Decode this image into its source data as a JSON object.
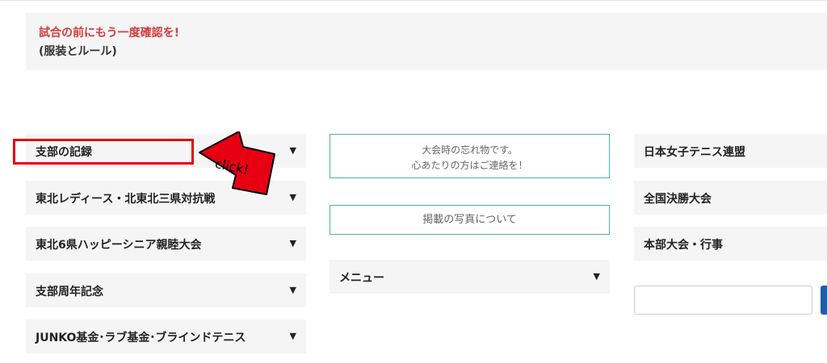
{
  "notice": {
    "line1": "試合の前にもう一度確認を!",
    "line2": "(服装とルール)"
  },
  "accordion": [
    {
      "label": "支部の記録"
    },
    {
      "label": "東北レディース・北東北三県対抗戦"
    },
    {
      "label": "東北6県ハッピーシニア親睦大会"
    },
    {
      "label": "支部周年記念"
    },
    {
      "label": "JUNKO基金･ラブ基金･ブラインドテニス"
    }
  ],
  "expand_arrow": "▼",
  "callout": {
    "text": "click!",
    "color": "#e60012"
  },
  "lost_found": {
    "line1": "大会時の忘れ物です。",
    "line2": "心あたりの方はご連絡を！"
  },
  "photos": {
    "label": "掲載の写真について"
  },
  "menu": {
    "label": "メニュー"
  },
  "links": [
    {
      "label": "日本女子テニス連盟"
    },
    {
      "label": "全国決勝大会"
    },
    {
      "label": "本部大会・行事"
    }
  ],
  "search": {
    "placeholder": ""
  },
  "colors": {
    "accent_red": "#d23c3c",
    "box_border": "#4fb3a3",
    "button_blue": "#1c5ea8"
  }
}
